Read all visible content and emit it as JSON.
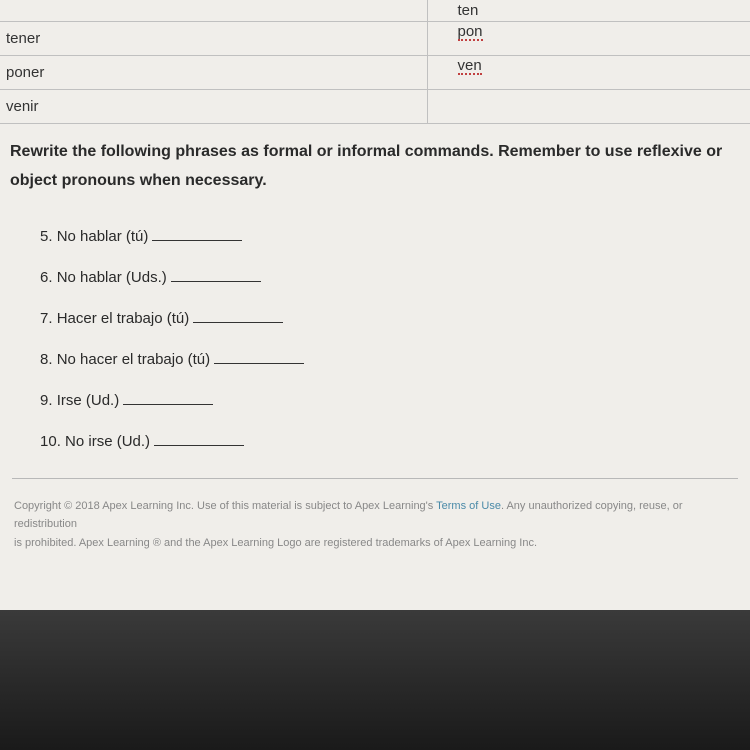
{
  "table": {
    "rows": [
      {
        "left": "",
        "right": "ten",
        "spellcheck": false
      },
      {
        "left": "tener",
        "right": "pon",
        "spellcheck": true
      },
      {
        "left": "poner",
        "right": "ven",
        "spellcheck": true
      },
      {
        "left": "venir",
        "right": "",
        "spellcheck": false
      }
    ]
  },
  "instructions": "Rewrite the following phrases as formal or informal commands. Remember to use reflexive or object pronouns when necessary.",
  "questions": [
    {
      "num": "5",
      "text": "No hablar (tú)"
    },
    {
      "num": "6",
      "text": "No hablar (Uds.)"
    },
    {
      "num": "7",
      "text": "Hacer el trabajo (tú)"
    },
    {
      "num": "8",
      "text": "No hacer el trabajo (tú)"
    },
    {
      "num": "9",
      "text": "Irse (Ud.)"
    },
    {
      "num": "10",
      "text": "No irse (Ud.)"
    }
  ],
  "footer": {
    "line1_pre": "Copyright © 2018 Apex Learning Inc. Use of this material is subject to Apex Learning's ",
    "link": "Terms of Use",
    "line1_post": ". Any unauthorized copying, reuse, or redistribution",
    "line2": "is prohibited. Apex Learning ® and the Apex Learning Logo are registered trademarks of Apex Learning Inc."
  }
}
